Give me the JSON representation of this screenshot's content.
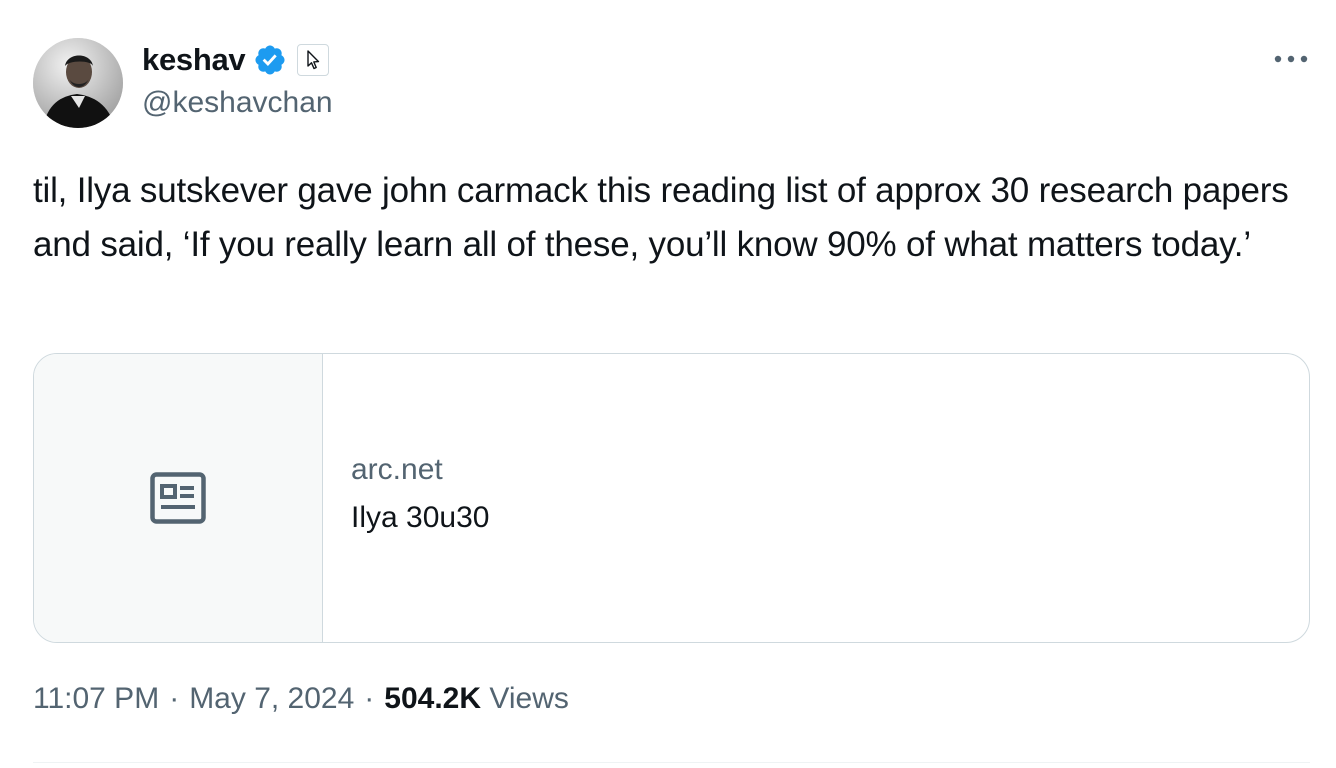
{
  "author": {
    "display_name": "keshav",
    "handle": "@keshavchan",
    "verified": true,
    "verified_color": "#1d9bf0",
    "avatar_icon": "avatar-photo"
  },
  "tweet": {
    "text": "til, Ilya sutskever gave john carmack this reading list of approx 30 research papers and said, ‘If you really learn all of these, you’ll know 90% of what matters today.’"
  },
  "link_card": {
    "icon": "article-icon",
    "domain": "arc.net",
    "title": "Ilya 30u30"
  },
  "meta": {
    "time": "11:07 PM",
    "separator": "·",
    "date": "May 7, 2024",
    "views_count": "504.2K",
    "views_label": "Views"
  },
  "colors": {
    "text_primary": "#0f1419",
    "text_secondary": "#536471",
    "border": "#cfd9de",
    "accent": "#1d9bf0"
  }
}
